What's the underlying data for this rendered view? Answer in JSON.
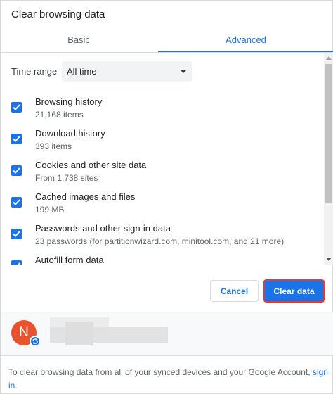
{
  "dialog": {
    "title": "Clear browsing data"
  },
  "tabs": [
    {
      "label": "Basic",
      "active": false
    },
    {
      "label": "Advanced",
      "active": true
    }
  ],
  "time_range": {
    "label": "Time range",
    "selected": "All time"
  },
  "items": [
    {
      "title": "Browsing history",
      "subtitle": "21,168 items",
      "checked": true
    },
    {
      "title": "Download history",
      "subtitle": "393 items",
      "checked": true
    },
    {
      "title": "Cookies and other site data",
      "subtitle": "From 1,738 sites",
      "checked": true
    },
    {
      "title": "Cached images and files",
      "subtitle": "199 MB",
      "checked": true
    },
    {
      "title": "Passwords and other sign-in data",
      "subtitle": "23 passwords (for partitionwizard.com, minitool.com, and 21 more)",
      "checked": true
    },
    {
      "title": "Autofill form data",
      "subtitle": "",
      "checked": true
    }
  ],
  "buttons": {
    "cancel": "Cancel",
    "clear": "Clear data"
  },
  "account": {
    "avatar_letter": "N"
  },
  "footer": {
    "text": "To clear browsing data from all of your synced devices and your Google Account,",
    "link": "sign in."
  },
  "colors": {
    "accent": "#1a73e8",
    "highlight_border": "#e53935",
    "avatar": "#e8522d"
  },
  "icons": [
    "check-icon",
    "dropdown-arrow-icon",
    "sync-icon",
    "scroll-up-icon",
    "scroll-down-icon"
  ]
}
